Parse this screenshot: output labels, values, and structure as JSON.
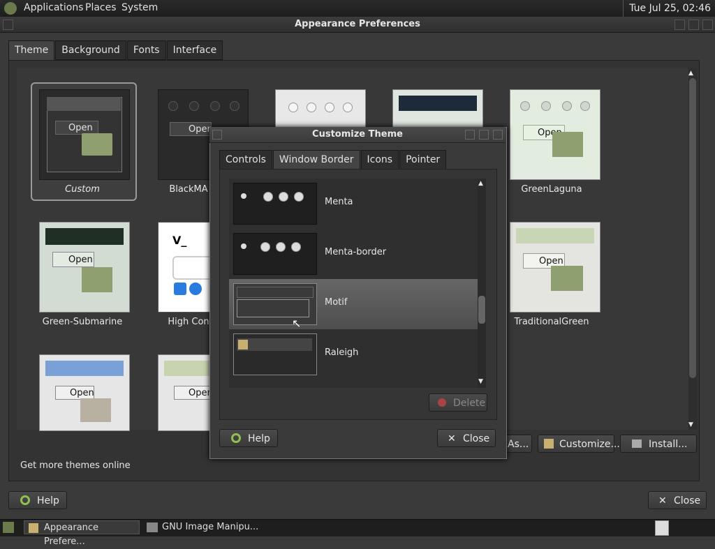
{
  "panel": {
    "menus": [
      "Applications",
      "Places",
      "System"
    ],
    "clock": "Tue Jul 25, 02:46"
  },
  "window": {
    "title": "Appearance Preferences",
    "tabs": [
      "Theme",
      "Background",
      "Fonts",
      "Interface"
    ],
    "themes": [
      {
        "name": "Custom"
      },
      {
        "name": "BlackMA"
      },
      {
        "name": ""
      },
      {
        "name": ""
      },
      {
        "name": "GreenLaguna"
      },
      {
        "name": "Green-Submarine"
      },
      {
        "name": "High Con"
      },
      {
        "name": "TraditionalGreen"
      }
    ],
    "thumb_text": {
      "open": "Open",
      "open_partial": "Open"
    },
    "get_more": "Get more themes online",
    "buttons": {
      "save_as": "As...",
      "customize": "Customize...",
      "install": "Install...",
      "help": "Help",
      "close": "Close"
    }
  },
  "dialog": {
    "title": "Customize Theme",
    "tabs": [
      "Controls",
      "Window Border",
      "Icons",
      "Pointer"
    ],
    "items": [
      {
        "name": "Menta"
      },
      {
        "name": "Menta-border"
      },
      {
        "name": "Motif",
        "selected": true
      },
      {
        "name": "Raleigh"
      }
    ],
    "delete": "Delete",
    "help": "Help",
    "close": "Close"
  },
  "taskbar": {
    "items": [
      "Appearance Prefere...",
      "GNU Image Manipu..."
    ]
  }
}
